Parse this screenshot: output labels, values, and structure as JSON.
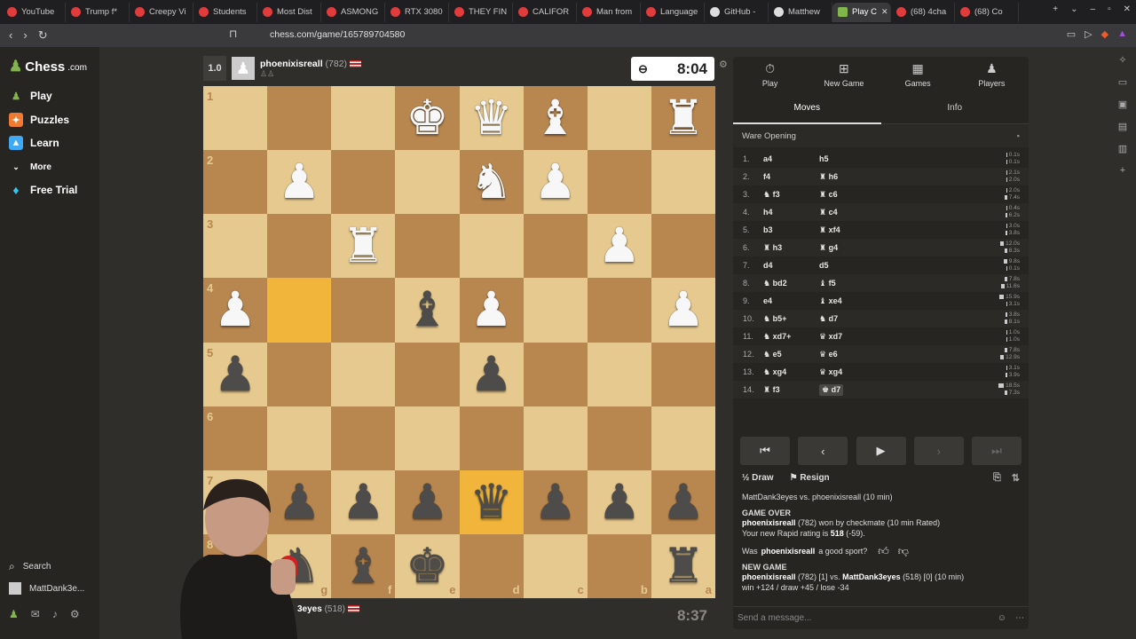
{
  "browser": {
    "tabs": [
      {
        "label": "YouTube",
        "icon": "youtube-icon"
      },
      {
        "label": "Trump f*",
        "icon": "youtube-icon"
      },
      {
        "label": "Creepy Vi",
        "icon": "youtube-icon"
      },
      {
        "label": "Students",
        "icon": "youtube-icon"
      },
      {
        "label": "Most Dist",
        "icon": "youtube-icon"
      },
      {
        "label": "ASMONG",
        "icon": "youtube-icon"
      },
      {
        "label": "RTX 3080",
        "icon": "youtube-icon"
      },
      {
        "label": "THEY FIN",
        "icon": "youtube-icon"
      },
      {
        "label": "CALIFOR",
        "icon": "youtube-icon"
      },
      {
        "label": "Man from",
        "icon": "youtube-icon"
      },
      {
        "label": "Language",
        "icon": "youtube-icon"
      },
      {
        "label": "GitHub -",
        "icon": "github-icon"
      },
      {
        "label": "Matthew",
        "icon": "globe-icon"
      },
      {
        "label": "Play C",
        "icon": "chess-icon",
        "active": true
      },
      {
        "label": "(68) 4cha",
        "icon": "youtube-icon"
      },
      {
        "label": "(68) Co",
        "icon": "youtube-icon"
      }
    ],
    "url": "chess.com/game/165789704580"
  },
  "sidebar": {
    "logo_text": "Chess",
    "logo_suffix": ".com",
    "items": [
      {
        "label": "Play",
        "icon": "play-pawn-icon",
        "color": "#81b64c"
      },
      {
        "label": "Puzzles",
        "icon": "puzzle-icon",
        "color": "#f07a32"
      },
      {
        "label": "Learn",
        "icon": "learn-icon",
        "color": "#3fa9f5"
      },
      {
        "label": "More",
        "icon": "chevron-down-icon"
      },
      {
        "label": "Free Trial",
        "icon": "diamond-icon",
        "color": "#36c5f0"
      }
    ],
    "search_label": "Search",
    "user_label": "MattDank3e..."
  },
  "game": {
    "top_player": {
      "score": "1.0",
      "name": "phoenixisreall",
      "rating": "(782)"
    },
    "bottom_player": {
      "name": "3eyes",
      "rating": "(518)"
    },
    "clock_top": "8:04",
    "clock_bottom": "8:37",
    "ranks": [
      "1",
      "2",
      "3",
      "4",
      "5",
      "6",
      "7",
      "8"
    ],
    "files": [
      "h",
      "g",
      "f",
      "e",
      "d",
      "c",
      "b",
      "a"
    ],
    "board": [
      [
        "",
        "",
        "",
        "wK",
        "wQ",
        "wB",
        "",
        "wR"
      ],
      [
        "",
        "wP",
        "",
        "",
        "wN",
        "wP",
        "",
        ""
      ],
      [
        "",
        "",
        "wR",
        "",
        "",
        "",
        "wP",
        ""
      ],
      [
        "wP",
        "",
        "",
        "bB",
        "wP",
        "",
        "",
        "wP"
      ],
      [
        "bP",
        "",
        "",
        "",
        "bP",
        "",
        "",
        ""
      ],
      [
        "",
        "",
        "",
        "",
        "",
        "",
        "",
        ""
      ],
      [
        "bP",
        "bP",
        "bP",
        "bP",
        "bQ",
        "bP",
        "bP",
        "bP"
      ],
      [
        "bR",
        "bN",
        "bB",
        "bK",
        "",
        "",
        "",
        "bR"
      ]
    ],
    "highlighted": [
      [
        3,
        1
      ],
      [
        6,
        4
      ]
    ]
  },
  "panel": {
    "tabs": [
      {
        "label": "Play",
        "icon": "stopwatch-icon"
      },
      {
        "label": "New Game",
        "icon": "plus-icon"
      },
      {
        "label": "Games",
        "icon": "games-grid-icon"
      },
      {
        "label": "Players",
        "icon": "players-icon"
      }
    ],
    "subtabs": [
      "Moves",
      "Info"
    ],
    "opening": "Ware Opening",
    "moves": [
      {
        "n": "1.",
        "w": "a4",
        "b": "h5",
        "tw": "0.1s",
        "tb": "0.1s"
      },
      {
        "n": "2.",
        "w": "f4",
        "b": "h6",
        "tw": "2.1s",
        "tb": "2.0s",
        "bp": "R"
      },
      {
        "n": "3.",
        "w": "f3",
        "b": "c6",
        "tw": "2.0s",
        "tb": "7.4s",
        "wp": "N",
        "bp": "R"
      },
      {
        "n": "4.",
        "w": "h4",
        "b": "c4",
        "tw": "0.4s",
        "tb": "6.2s",
        "bp": "R"
      },
      {
        "n": "5.",
        "w": "b3",
        "b": "xf4",
        "tw": "3.0s",
        "tb": "3.8s",
        "bp": "R"
      },
      {
        "n": "6.",
        "w": "h3",
        "b": "g4",
        "tw": "12.0s",
        "tb": "8.3s",
        "wp": "R",
        "bp": "R"
      },
      {
        "n": "7.",
        "w": "d4",
        "b": "d5",
        "tw": "9.8s",
        "tb": "0.1s"
      },
      {
        "n": "8.",
        "w": "bd2",
        "b": "f5",
        "tw": "7.8s",
        "tb": "11.6s",
        "wp": "N",
        "bp": "B"
      },
      {
        "n": "9.",
        "w": "e4",
        "b": "xe4",
        "tw": "15.9s",
        "tb": "3.1s",
        "bp": "B"
      },
      {
        "n": "10.",
        "w": "b5+",
        "b": "d7",
        "tw": "3.8s",
        "tb": "8.1s",
        "wp": "N",
        "bp": "N"
      },
      {
        "n": "11.",
        "w": "xd7+",
        "b": "xd7",
        "tw": "1.0s",
        "tb": "1.0s",
        "wp": "N",
        "bp": "Q"
      },
      {
        "n": "12.",
        "w": "e5",
        "b": "e6",
        "tw": "7.8s",
        "tb": "12.9s",
        "wp": "N",
        "bp": "Q"
      },
      {
        "n": "13.",
        "w": "xg4",
        "b": "xg4",
        "tw": "3.1s",
        "tb": "3.9s",
        "wp": "N",
        "bp": "Q"
      },
      {
        "n": "14.",
        "w": "f3",
        "b": "d7",
        "tw": "18.5s",
        "tb": "7.3s",
        "wp": "R",
        "bp": "K"
      }
    ],
    "draw_label": "Draw",
    "resign_label": "Resign",
    "log": {
      "matchup": "MattDank3eyes vs. phoenixisreall (10 min)",
      "game_over": "GAME OVER",
      "winner": "phoenixisreall",
      "winner_rest": "(782) won by checkmate (10 min Rated)",
      "rating_line_pre": "Your new Rapid rating is",
      "rating_value": "518",
      "rating_delta": "(-59).",
      "sport_pre": "Was",
      "sport_name": "phoenixisreall",
      "sport_post": "a good sport?",
      "new_game": "NEW GAME",
      "ng_line1_name": "phoenixisreall",
      "ng_line1_mid": "(782) [1] vs.",
      "ng_line1_name2": "MattDank3eyes",
      "ng_line1_end": "(518) [0] (10 min)",
      "ng_line2": "win +124 / draw +45 / lose -34"
    },
    "message_placeholder": "Send a message..."
  }
}
